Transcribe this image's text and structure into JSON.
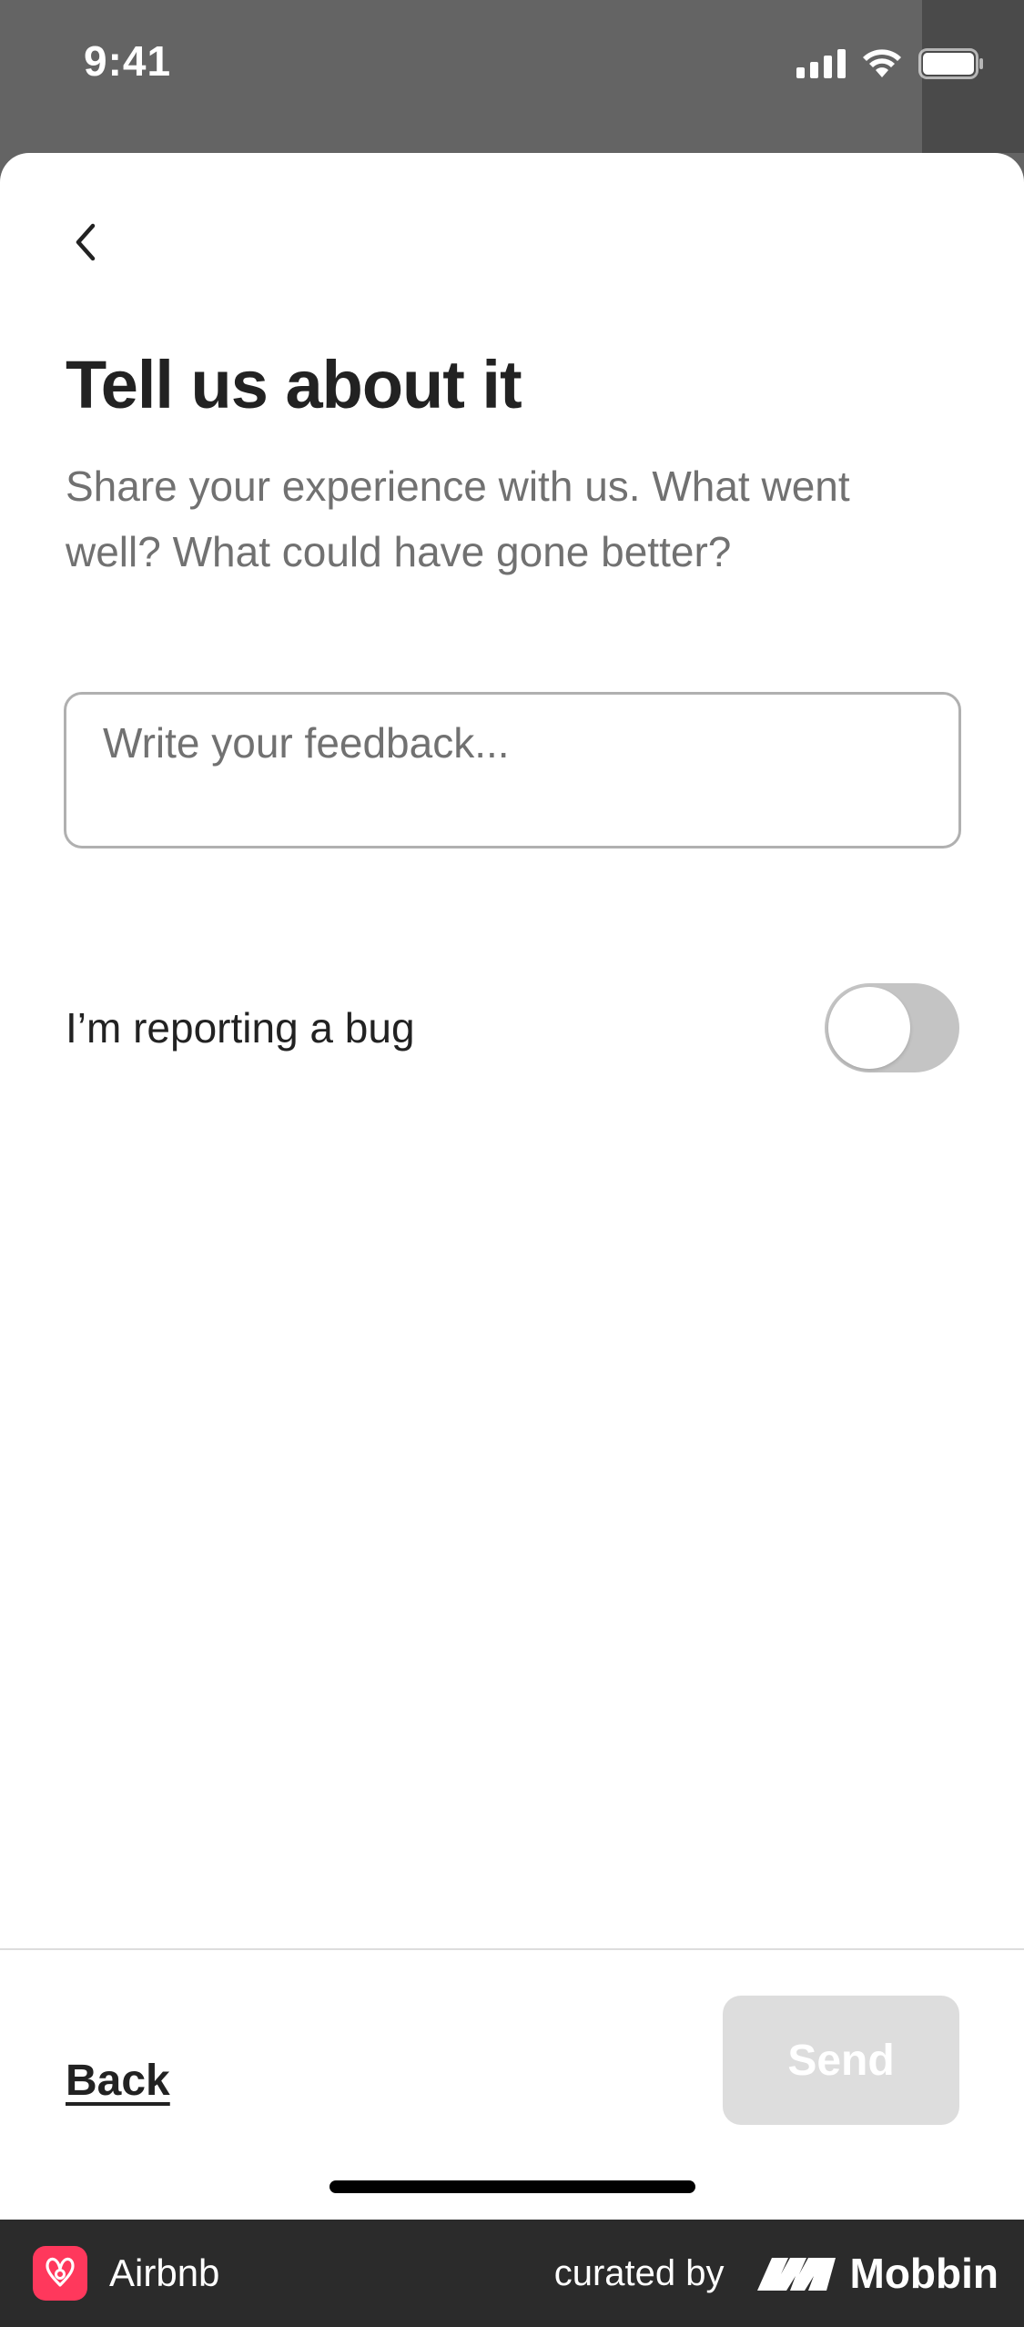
{
  "status_bar": {
    "time": "9:41",
    "icons": [
      "signal-icon",
      "wifi-icon",
      "battery-icon"
    ]
  },
  "page": {
    "title": "Tell us about it",
    "subtitle": "Share your experience with us. What went well? What could have gone better?",
    "feedback_placeholder": "Write your feedback...",
    "feedback_value": "",
    "bug_toggle_label": "I’m reporting a bug",
    "bug_toggle_on": false
  },
  "footer": {
    "back_label": "Back",
    "send_label": "Send"
  },
  "brand_bar": {
    "app_name": "Airbnb",
    "curated_by": "curated by",
    "curator": "Mobbin"
  },
  "colors": {
    "accent": "#FF385C",
    "text_primary": "#222222",
    "text_secondary": "#717171",
    "disabled_button": "#DDDDDD",
    "toggle_off": "#C4C4C4"
  }
}
